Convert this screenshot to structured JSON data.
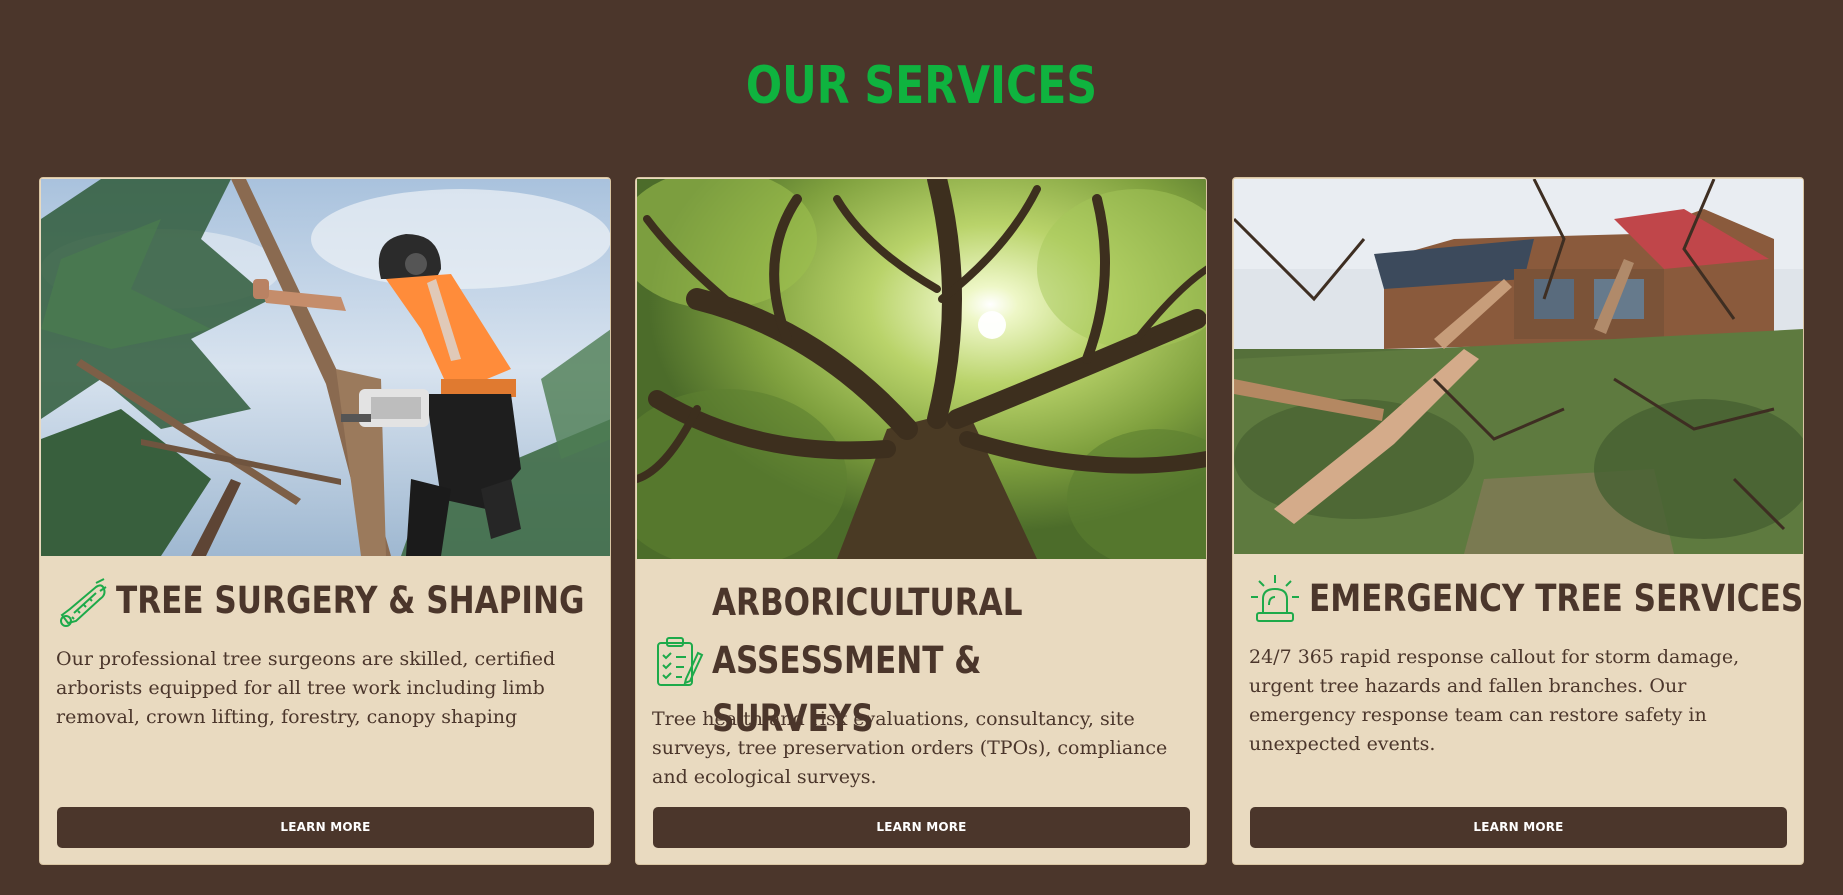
{
  "page": {
    "title": "OUR SERVICES",
    "title_color": "#0fb33f",
    "background_color": "#4b362b",
    "card_color": "#e9dac0"
  },
  "services": [
    {
      "icon": "chainsaw-icon",
      "title": "TREE SURGERY & SHAPING",
      "description": "Our professional tree surgeons are skilled, certified arborists equipped for all tree work including limb removal, crown lifting, forestry, canopy shaping",
      "button_label": "LEARN MORE"
    },
    {
      "icon": "clipboard-checklist-icon",
      "title": "ARBORICULTURAL ASSESSMENT & SURVEYS",
      "description": "Tree health and risk evaluations, consultancy, site surveys, tree preservation orders (TPOs), compliance and ecological surveys.",
      "button_label": "LEARN MORE"
    },
    {
      "icon": "emergency-siren-icon",
      "title": "EMERGENCY TREE SERVICES",
      "description": "24/7 365 rapid response callout for storm damage, urgent tree hazards and fallen branches. Our emergency response team can restore safety in unexpected events.",
      "button_label": "LEARN MORE"
    }
  ]
}
